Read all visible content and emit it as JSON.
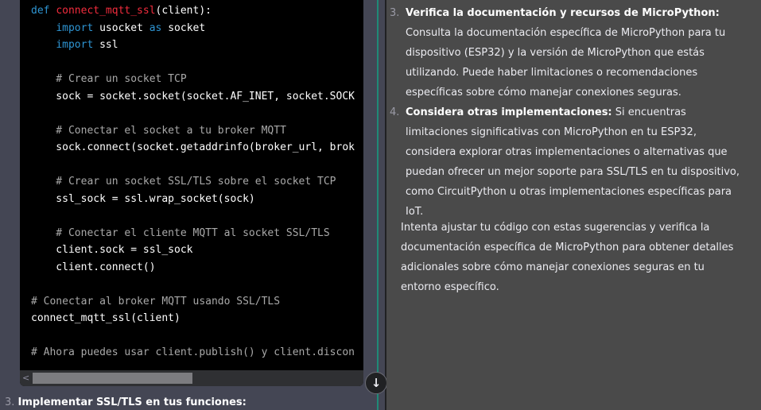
{
  "code": {
    "lines": [
      [
        {
          "t": "def ",
          "c": "kw"
        },
        {
          "t": "connect_mqtt_ssl",
          "c": "fn"
        },
        {
          "t": "(client):",
          "c": ""
        }
      ],
      [
        {
          "t": "    ",
          "c": ""
        },
        {
          "t": "import",
          "c": "kw"
        },
        {
          "t": " usocket ",
          "c": ""
        },
        {
          "t": "as",
          "c": "kw"
        },
        {
          "t": " socket",
          "c": ""
        }
      ],
      [
        {
          "t": "    ",
          "c": ""
        },
        {
          "t": "import",
          "c": "kw"
        },
        {
          "t": " ssl",
          "c": ""
        }
      ],
      [],
      [
        {
          "t": "    # Crear un socket TCP",
          "c": "cm"
        }
      ],
      [
        {
          "t": "    sock = socket.socket(socket.AF_INET, socket.SOCK",
          "c": ""
        }
      ],
      [],
      [
        {
          "t": "    # Conectar el socket a tu broker MQTT",
          "c": "cm"
        }
      ],
      [
        {
          "t": "    sock.connect(socket.getaddrinfo(broker_url, brok",
          "c": ""
        }
      ],
      [],
      [
        {
          "t": "    # Crear un socket SSL/TLS sobre el socket TCP",
          "c": "cm"
        }
      ],
      [
        {
          "t": "    ssl_sock = ssl.wrap_socket(sock)",
          "c": ""
        }
      ],
      [],
      [
        {
          "t": "    # Conectar el cliente MQTT al socket SSL/TLS",
          "c": "cm"
        }
      ],
      [
        {
          "t": "    client.sock = ssl_sock",
          "c": ""
        }
      ],
      [
        {
          "t": "    client.connect()",
          "c": ""
        }
      ],
      [],
      [
        {
          "t": "# Conectar al broker MQTT usando SSL/TLS",
          "c": "cm"
        }
      ],
      [
        {
          "t": "connect_mqtt_ssl(client)",
          "c": ""
        }
      ],
      [],
      [
        {
          "t": "# Ahora puedes usar client.publish() y client.discon",
          "c": "cm"
        }
      ]
    ]
  },
  "scroll": {
    "left_arrow": "<",
    "down_arrow": "↓"
  },
  "left_bottom": {
    "num": "3.",
    "title": "Implementar SSL/TLS en tus funciones:"
  },
  "right": {
    "item3": {
      "num": "3.",
      "title": "Verifica la documentación y recursos de MicroPython:",
      "body": " Consulta la documentación específica de MicroPython para tu dispositivo (ESP32) y la versión de MicroPython que estás utilizando. Puede haber limitaciones o recomendaciones específicas sobre cómo manejar conexiones seguras."
    },
    "item4": {
      "num": "4.",
      "title": "Considera otras implementaciones:",
      "body": " Si encuentras limitaciones significativas con MicroPython en tu ESP32, considera explorar otras implementaciones o alternativas que puedan ofrecer un mejor soporte para SSL/TLS en tu dispositivo, como CircuitPython u otras implementaciones específicas para IoT."
    },
    "paragraph": "Intenta ajustar tu código con estas sugerencias y verifica la documentación específica de MicroPython para obtener detalles adicionales sobre cómo manejar conexiones seguras en tu entorno específico."
  }
}
